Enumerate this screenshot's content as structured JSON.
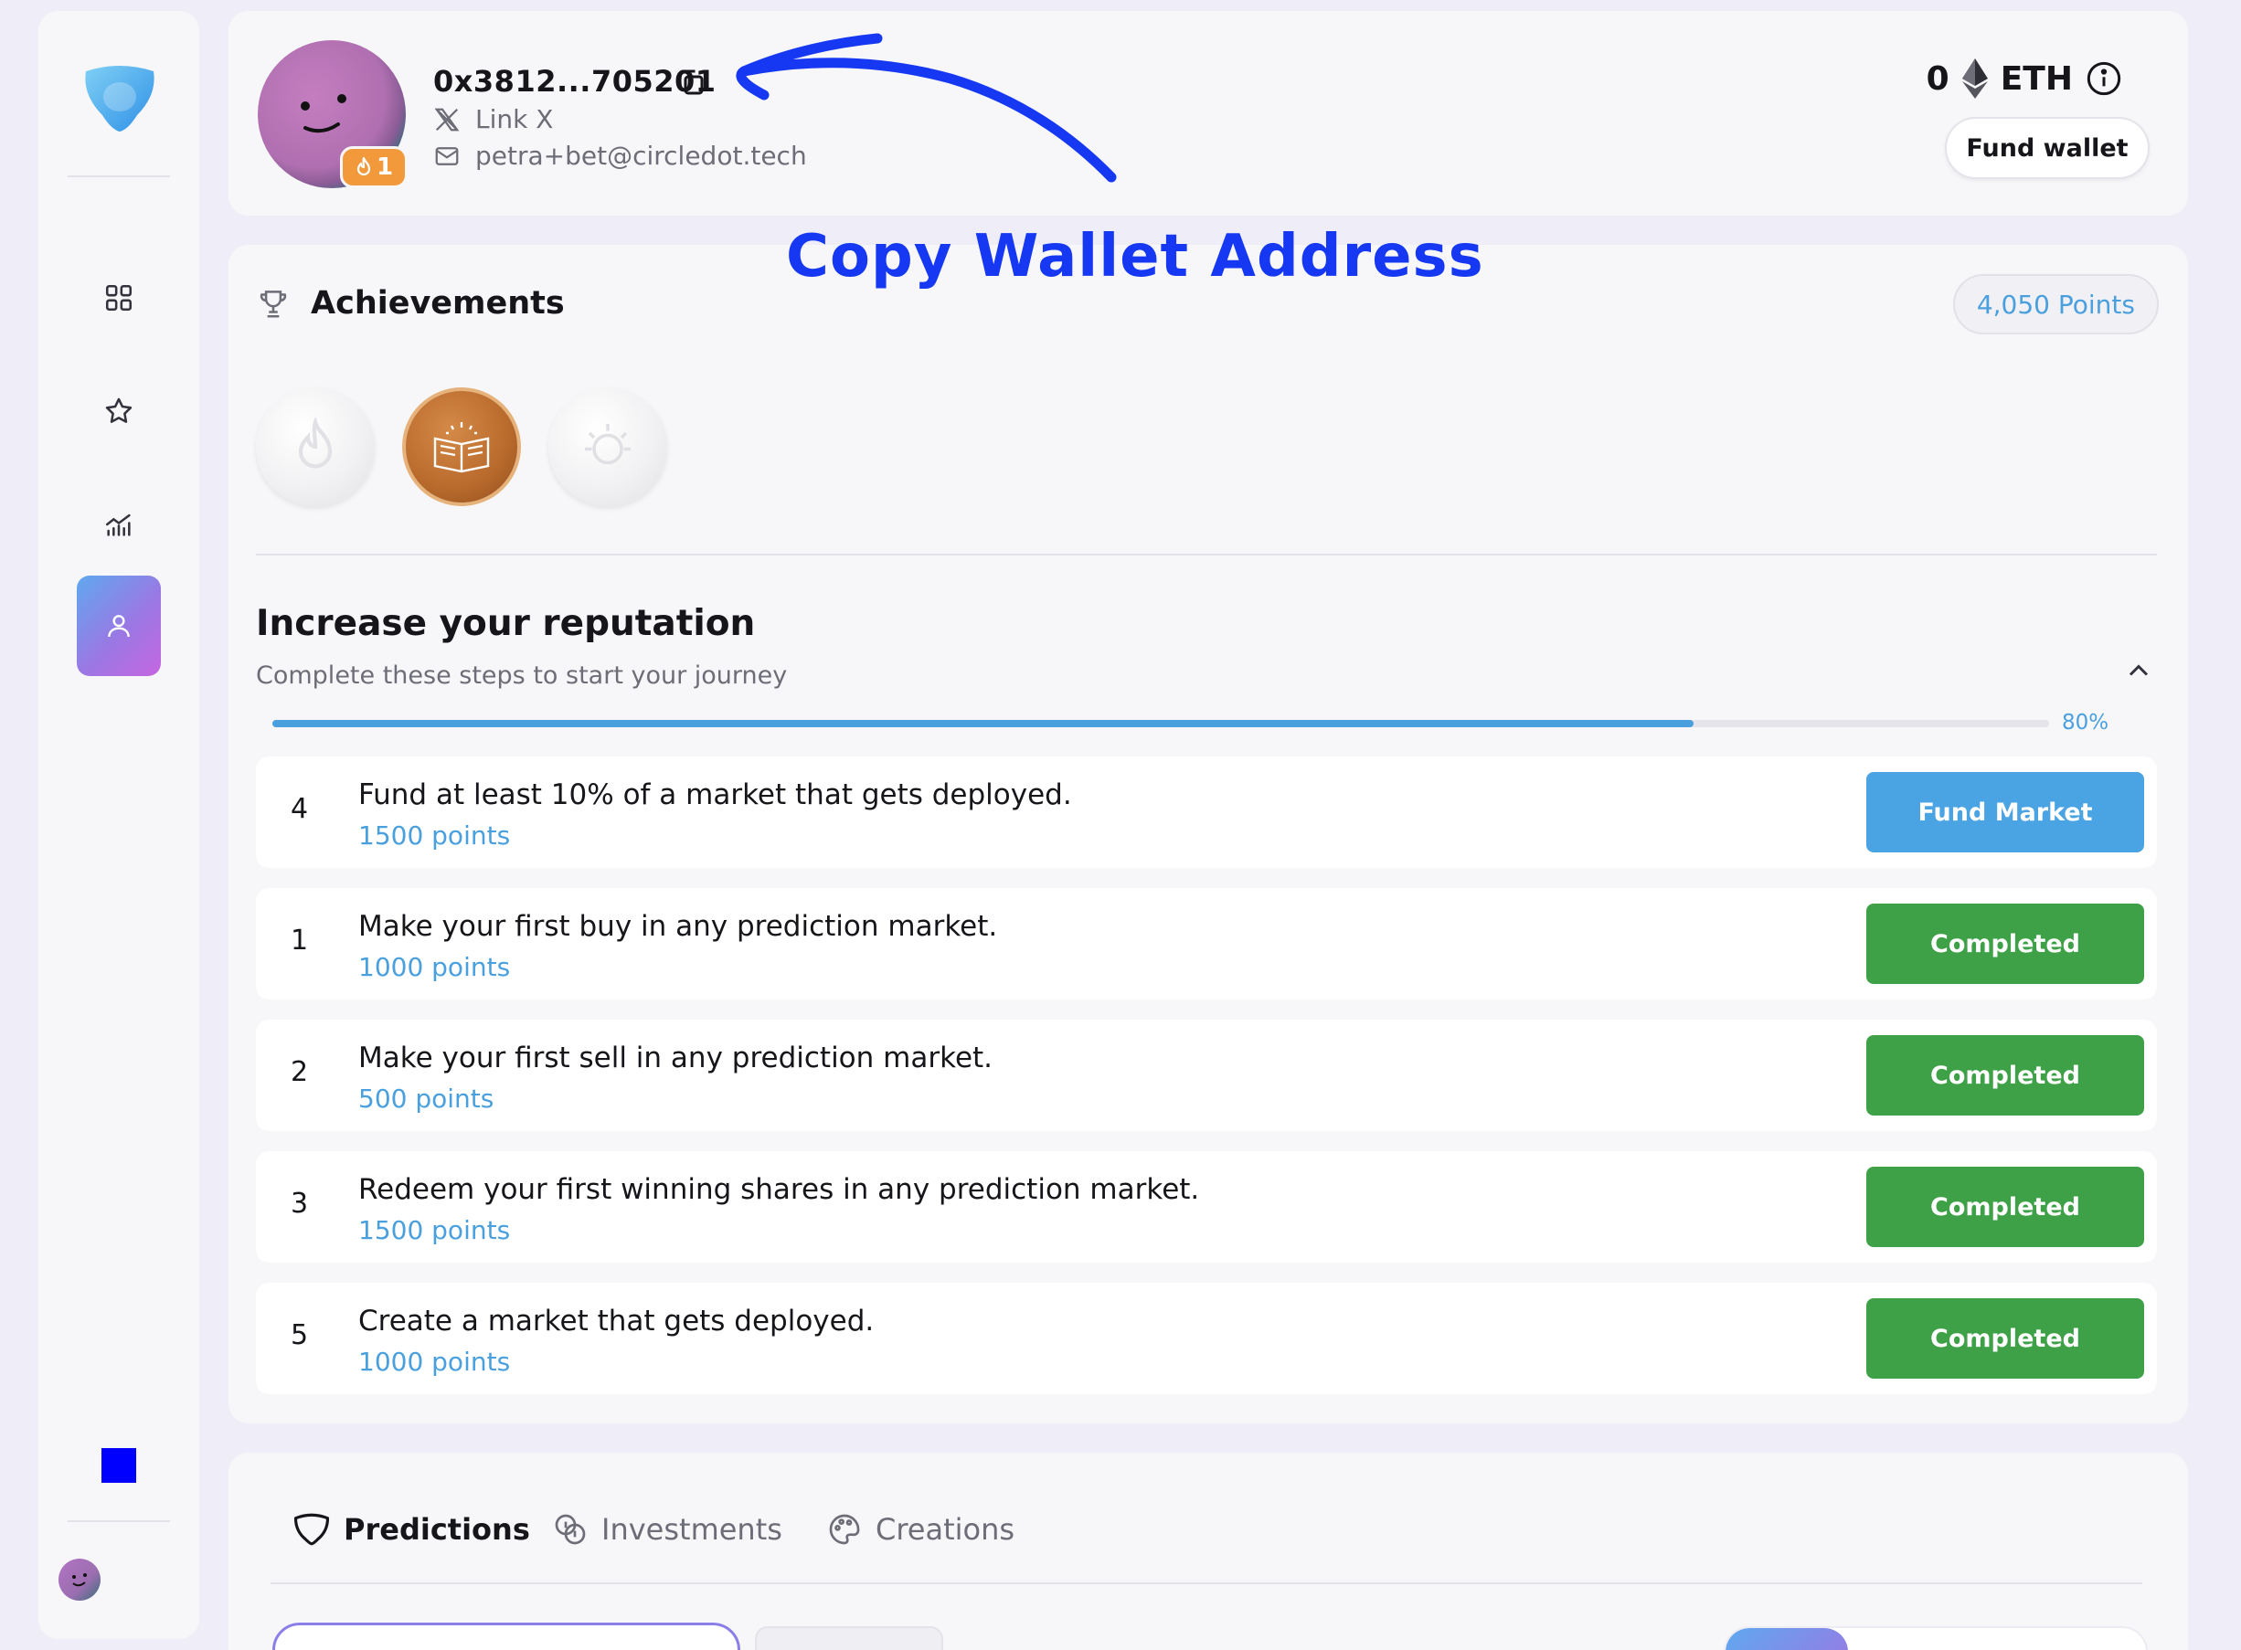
{
  "sidebar": {
    "nav": [
      {
        "name": "grid-icon"
      },
      {
        "name": "star-icon"
      },
      {
        "name": "chart-icon"
      },
      {
        "name": "user-icon"
      }
    ],
    "accent": "#0000ff"
  },
  "profile": {
    "wallet_address": "0x3812...705201",
    "streak_count": "1",
    "link_x_label": "Link X",
    "email": "petra+bet@circledot.tech",
    "balance_value": "0",
    "balance_currency": "ETH",
    "fund_wallet_label": "Fund wallet"
  },
  "annotation": {
    "text": "Copy Wallet Address",
    "color": "#1638f2"
  },
  "achievements": {
    "title": "Achievements",
    "points": "4,050 Points",
    "badges": [
      {
        "name": "fire-badge",
        "earned": false
      },
      {
        "name": "book-badge",
        "earned": true
      },
      {
        "name": "bulb-badge",
        "earned": false
      }
    ]
  },
  "reputation": {
    "title": "Increase your reputation",
    "subtitle": "Complete these steps to start your journey",
    "progress_percent": 80,
    "progress_label": "80%",
    "steps": [
      {
        "num": "4",
        "text": "Fund at least 10% of a market that gets deployed.",
        "points": "1500 points",
        "button": "Fund Market",
        "status": "pending"
      },
      {
        "num": "1",
        "text": "Make your first buy in any prediction market.",
        "points": "1000 points",
        "button": "Completed",
        "status": "done"
      },
      {
        "num": "2",
        "text": "Make your first sell in any prediction market.",
        "points": "500 points",
        "button": "Completed",
        "status": "done"
      },
      {
        "num": "3",
        "text": "Redeem your first winning shares in any prediction market.",
        "points": "1500 points",
        "button": "Completed",
        "status": "done"
      },
      {
        "num": "5",
        "text": "Create a market that gets deployed.",
        "points": "1000 points",
        "button": "Completed",
        "status": "done"
      }
    ]
  },
  "tabs": [
    {
      "label": "Predictions",
      "icon": "shield-icon",
      "active": true
    },
    {
      "label": "Investments",
      "icon": "coins-icon",
      "active": false
    },
    {
      "label": "Creations",
      "icon": "palette-icon",
      "active": false
    }
  ],
  "colors": {
    "blue_accent": "#4aa0de",
    "completed_green": "#3fa147",
    "fund_blue": "#4aa3e2"
  }
}
